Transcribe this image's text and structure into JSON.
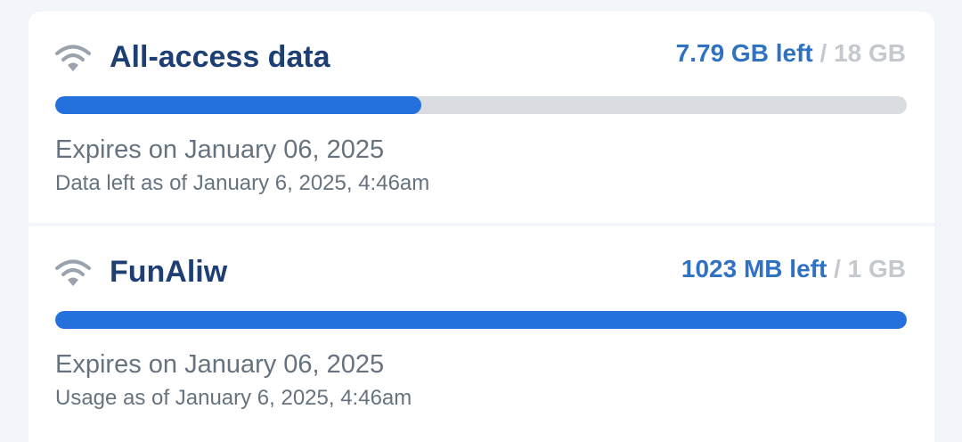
{
  "plans": [
    {
      "icon": "wifi-icon",
      "title": "All-access data",
      "remaining": "7.79 GB left",
      "separator": "/",
      "total": "18 GB",
      "remaining_fraction": 0.43,
      "expires": "Expires on January 06, 2025",
      "as_of": "Data left as of January 6, 2025, 4:46am"
    },
    {
      "icon": "wifi-icon",
      "title": "FunAliw",
      "remaining": "1023 MB left",
      "separator": "/",
      "total": "1 GB",
      "remaining_fraction": 1.0,
      "expires": "Expires on January 06, 2025",
      "as_of": "Usage as of January 6, 2025, 4:46am"
    }
  ],
  "colors": {
    "title": "#1d3f73",
    "remaining": "#2f72c4",
    "total": "#c4c9cf",
    "bar_fill": "#2470dc",
    "bar_track": "#d9dde2",
    "meta_text": "#66737f",
    "wifi_icon": "#9aa3ad"
  }
}
